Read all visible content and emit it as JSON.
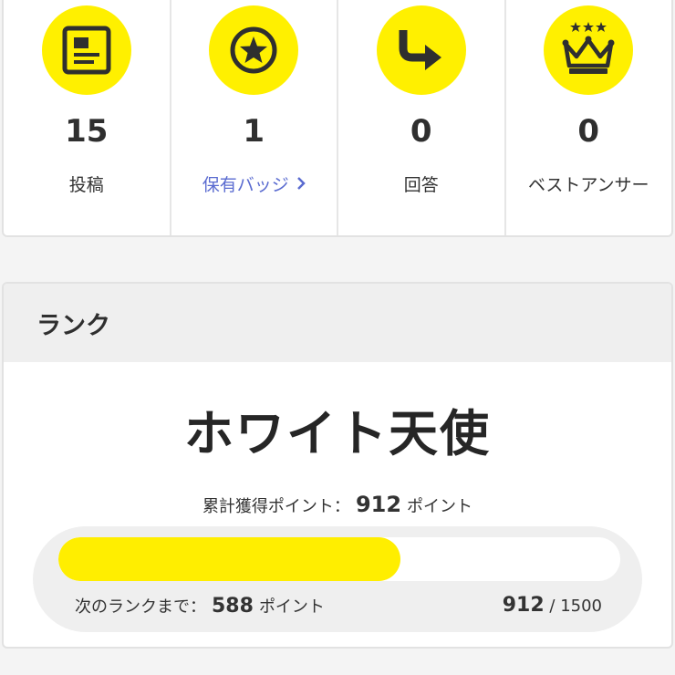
{
  "stats": [
    {
      "icon": "document-icon",
      "value": "15",
      "label": "投稿",
      "link": false
    },
    {
      "icon": "star-badge-icon",
      "value": "1",
      "label": "保有バッジ",
      "link": true
    },
    {
      "icon": "arrow-reply-icon",
      "value": "0",
      "label": "回答",
      "link": false
    },
    {
      "icon": "crown-icon",
      "value": "0",
      "label": "ベストアンサー",
      "link": false
    }
  ],
  "rank": {
    "header": "ランク",
    "name": "ホワイト天使",
    "total_label": "累計獲得ポイント：",
    "total_points": "912",
    "points_unit": "ポイント",
    "next_label": "次のランクまで：",
    "next_points": "588",
    "current": "912",
    "separator": "/",
    "target": "1500",
    "progress_fraction": 0.608
  },
  "colors": {
    "accent": "#fff000",
    "link": "#5a6bd0"
  }
}
